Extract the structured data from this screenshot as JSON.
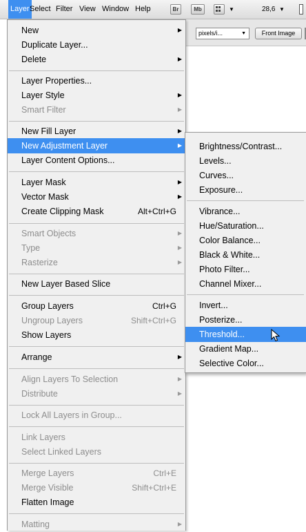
{
  "menubar": {
    "items": [
      "Layer",
      "Select",
      "Filter",
      "View",
      "Window",
      "Help"
    ],
    "icons": [
      {
        "name": "bridge-icon",
        "text": "Br"
      },
      {
        "name": "minibridge-icon",
        "text": "Mb"
      },
      {
        "name": "view-extras-icon",
        "text": ""
      }
    ],
    "zoom": "28,6"
  },
  "options_bar": {
    "units_value": "pixels/i...",
    "front_image_label": "Front Image"
  },
  "layer_menu": {
    "new": "New",
    "duplicate": "Duplicate Layer...",
    "delete": "Delete",
    "properties": "Layer Properties...",
    "style": "Layer Style",
    "smart_filter": "Smart Filter",
    "new_fill": "New Fill Layer",
    "new_adjustment": "New Adjustment Layer",
    "content_options": "Layer Content Options...",
    "layer_mask": "Layer Mask",
    "vector_mask": "Vector Mask",
    "clipping_mask": "Create Clipping Mask",
    "clipping_mask_sc": "Alt+Ctrl+G",
    "smart_objects": "Smart Objects",
    "type": "Type",
    "rasterize": "Rasterize",
    "new_slice": "New Layer Based Slice",
    "group": "Group Layers",
    "group_sc": "Ctrl+G",
    "ungroup": "Ungroup Layers",
    "ungroup_sc": "Shift+Ctrl+G",
    "show_layers": "Show Layers",
    "arrange": "Arrange",
    "align": "Align Layers To Selection",
    "distribute": "Distribute",
    "lock_all": "Lock All Layers in Group...",
    "link": "Link Layers",
    "select_linked": "Select Linked Layers",
    "merge": "Merge Layers",
    "merge_sc": "Ctrl+E",
    "merge_visible": "Merge Visible",
    "merge_visible_sc": "Shift+Ctrl+E",
    "flatten": "Flatten Image",
    "matting": "Matting"
  },
  "adjustment_submenu": {
    "brightness": "Brightness/Contrast...",
    "levels": "Levels...",
    "curves": "Curves...",
    "exposure": "Exposure...",
    "vibrance": "Vibrance...",
    "hue_sat": "Hue/Saturation...",
    "color_balance": "Color Balance...",
    "black_white": "Black & White...",
    "photo_filter": "Photo Filter...",
    "channel_mixer": "Channel Mixer...",
    "invert": "Invert...",
    "posterize": "Posterize...",
    "threshold": "Threshold...",
    "gradient_map": "Gradient Map...",
    "selective_color": "Selective Color..."
  },
  "colors": {
    "highlight": "#3e8ff0",
    "menu_bg": "#f0f0f0",
    "disabled_text": "#8d8d8d"
  }
}
